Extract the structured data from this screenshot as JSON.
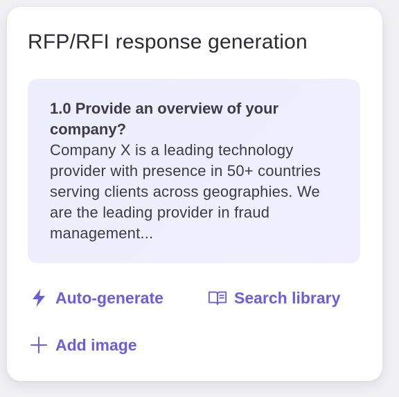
{
  "card": {
    "title": "RFP/RFI response generation"
  },
  "qa": {
    "question": "1.0 Provide an overview of your company?",
    "answer": "Company X is a leading technology provider with presence in 50+ countries serving clients across geographies. We are the leading provider in fraud management..."
  },
  "actions": {
    "auto_generate": {
      "label": "Auto-generate",
      "icon": "lightning-bolt-icon"
    },
    "search_library": {
      "label": "Search library",
      "icon": "open-book-icon"
    },
    "add_image": {
      "label": "Add image",
      "icon": "plus-icon"
    }
  },
  "colors": {
    "accent": "#6d5dde",
    "text": "#3c3c46",
    "panel": "#eeeefc"
  }
}
